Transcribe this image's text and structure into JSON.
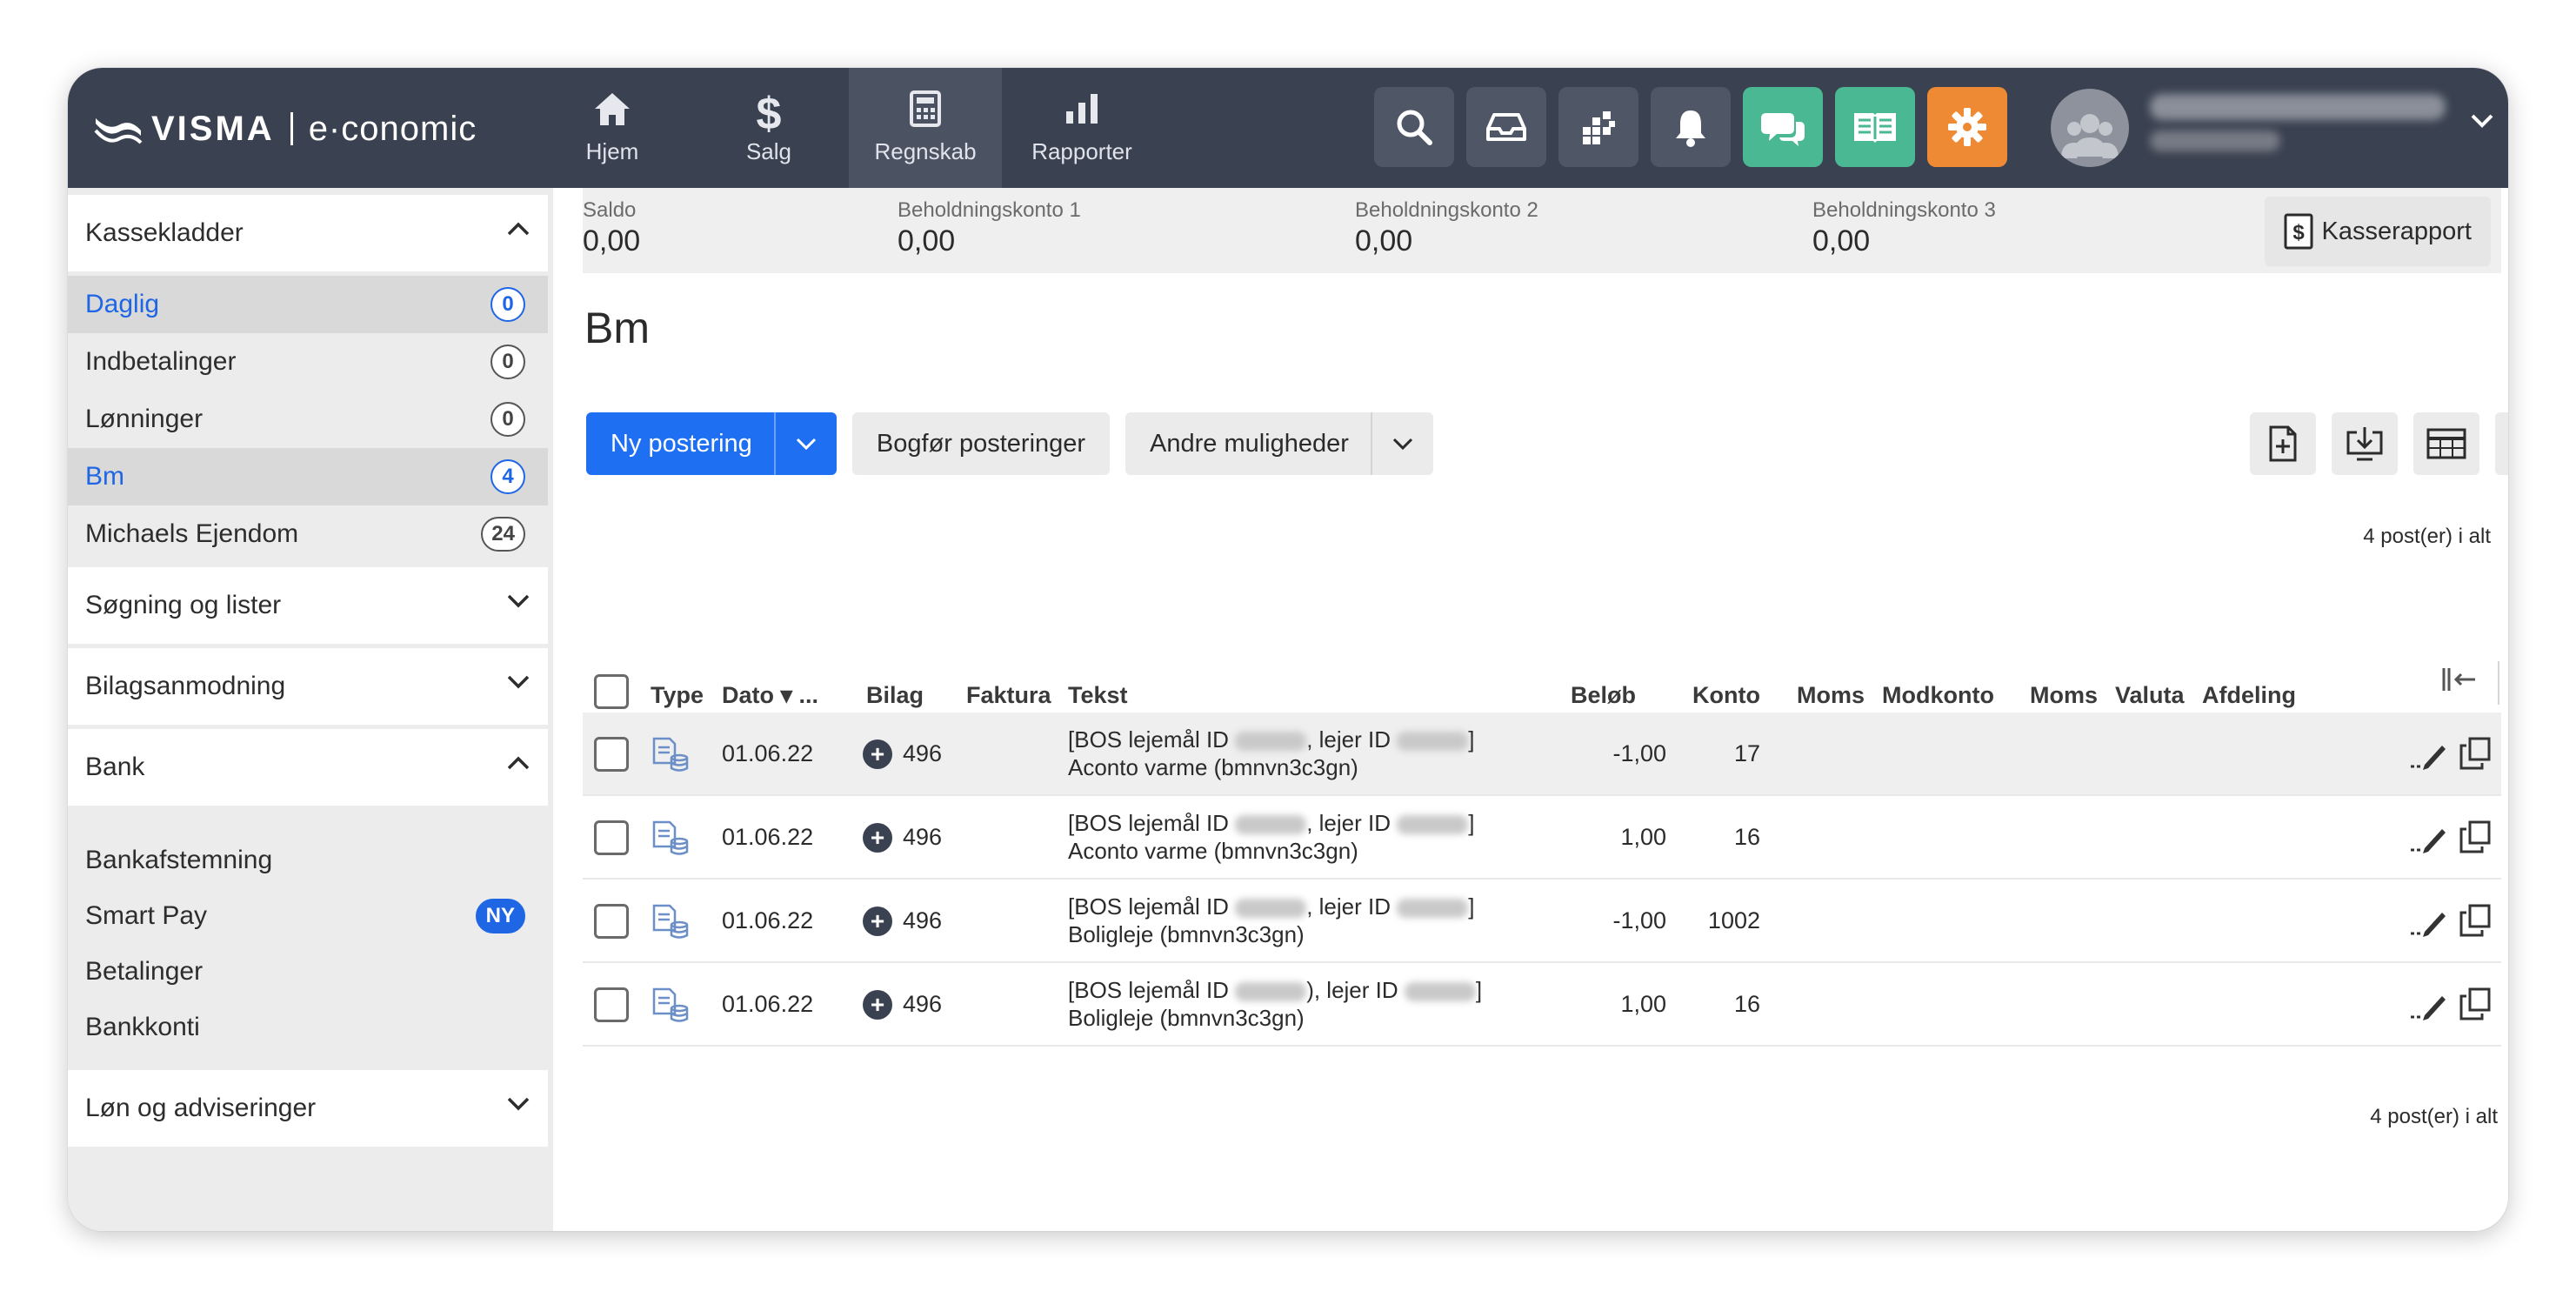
{
  "brand": {
    "name": "VISMA",
    "product": "e·conomic"
  },
  "nav": [
    {
      "label": "Hjem",
      "icon": "home-icon"
    },
    {
      "label": "Salg",
      "icon": "dollar-icon"
    },
    {
      "label": "Regnskab",
      "icon": "calculator-icon",
      "active": true
    },
    {
      "label": "Rapporter",
      "icon": "bar-chart-icon"
    }
  ],
  "toolbar_icons": [
    "search-icon",
    "inbox-icon",
    "apps-grid-icon",
    "bell-icon",
    "chat-icon",
    "book-icon",
    "gear-icon"
  ],
  "colors": {
    "topbar": "#3a4150",
    "primary": "#1f6ff2",
    "green": "#4ab893",
    "orange": "#ee8a33",
    "selected_text": "#1f66e5"
  },
  "sidebar": {
    "kassekladder": {
      "title": "Kassekladder",
      "items": [
        {
          "label": "Daglig",
          "count": "0"
        },
        {
          "label": "Indbetalinger",
          "count": "0"
        },
        {
          "label": "Lønninger",
          "count": "0"
        },
        {
          "label": "Bm",
          "count": "4"
        },
        {
          "label": "Michaels Ejendom",
          "count": "24"
        }
      ]
    },
    "soegning": {
      "title": "Søgning og lister"
    },
    "bilagsanmodning": {
      "title": "Bilagsanmodning"
    },
    "bank": {
      "title": "Bank",
      "items": [
        {
          "label": "Bankafstemning"
        },
        {
          "label": "Smart Pay",
          "badge": "NY"
        },
        {
          "label": "Betalinger"
        },
        {
          "label": "Bankkonti"
        }
      ]
    },
    "loen": {
      "title": "Løn og adviseringer"
    }
  },
  "saldo": [
    {
      "label": "Saldo",
      "value": "0,00"
    },
    {
      "label": "Beholdningskonto 1",
      "value": "0,00"
    },
    {
      "label": "Beholdningskonto 2",
      "value": "0,00"
    },
    {
      "label": "Beholdningskonto 3",
      "value": "0,00"
    }
  ],
  "kasserapport_label": "Kasserapport",
  "page_title": "Bm",
  "actions": {
    "ny_postering": "Ny postering",
    "bogfoer": "Bogfør posteringer",
    "andre": "Andre muligheder"
  },
  "count_label": "4 post(er) i alt",
  "table": {
    "headers": {
      "type": "Type",
      "dato": "Dato ▾ ...",
      "bilag": "Bilag",
      "faktura": "Faktura",
      "tekst": "Tekst",
      "beloeb": "Beløb",
      "konto": "Konto",
      "moms": "Moms",
      "modkonto": "Modkonto",
      "moms2": "Moms",
      "valuta": "Valuta",
      "afdeling": "Afdeling"
    },
    "rows": [
      {
        "dato": "01.06.22",
        "bilag": "496",
        "t1a": "[BOS lejemål ID",
        "t1b": ", lejer ID",
        "t1c": "]",
        "t2": "Aconto varme (bmnvn3c3gn)",
        "beloeb": "-1,00",
        "konto": "17"
      },
      {
        "dato": "01.06.22",
        "bilag": "496",
        "t1a": "[BOS lejemål ID",
        "t1b": ", lejer ID",
        "t1c": "]",
        "t2": "Aconto varme (bmnvn3c3gn)",
        "beloeb": "1,00",
        "konto": "16"
      },
      {
        "dato": "01.06.22",
        "bilag": "496",
        "t1a": "[BOS lejemål ID",
        "t1b": ", lejer ID",
        "t1c": "]",
        "t2": "Boligleje (bmnvn3c3gn)",
        "beloeb": "-1,00",
        "konto": "1002"
      },
      {
        "dato": "01.06.22",
        "bilag": "496",
        "t1a": "[BOS lejemål ID",
        "t1b": "), lejer ID",
        "t1c": "]",
        "t2": "Boligleje (bmnvn3c3gn)",
        "beloeb": "1,00",
        "konto": "16"
      }
    ]
  }
}
